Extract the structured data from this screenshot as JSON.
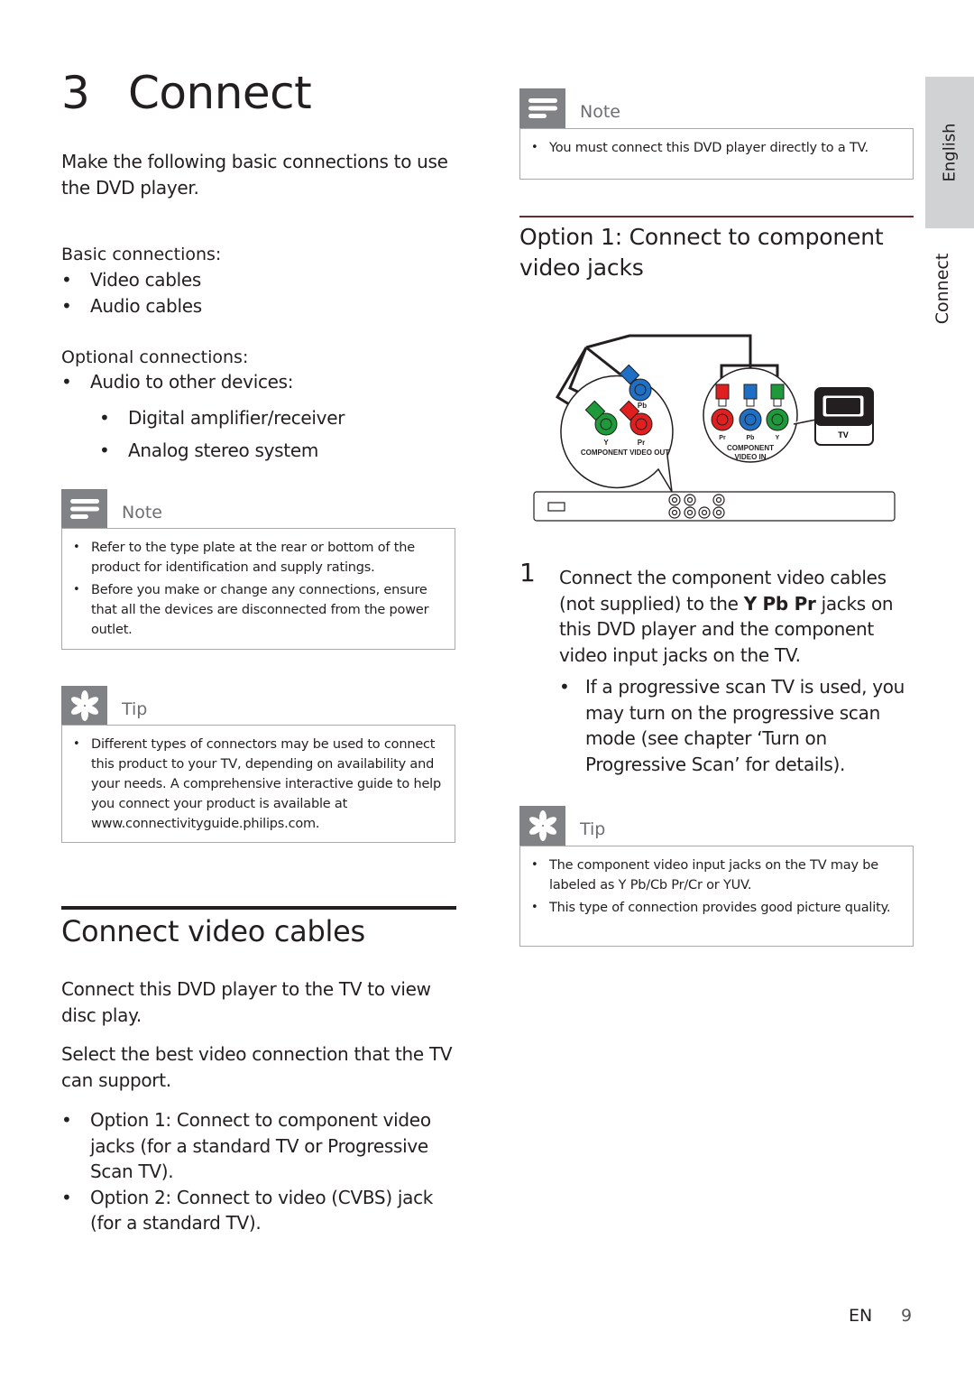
{
  "chapter": {
    "number": "3",
    "title": "Connect"
  },
  "intro": "Make the following basic connections to use the DVD player.",
  "basic": {
    "heading": "Basic connections:",
    "items": [
      "Video cables",
      "Audio cables"
    ]
  },
  "optional": {
    "heading": "Optional connections:",
    "item": "Audio to other devices:",
    "subitems": [
      "Digital amplifier/receiver",
      "Analog stereo system"
    ]
  },
  "note_left": {
    "title": "Note",
    "items": [
      "Refer to the type plate at the rear or bottom of the product for identification and supply ratings.",
      "Before you make or change any connections, ensure that all the devices are disconnected from the power outlet."
    ]
  },
  "tip_left": {
    "title": "Tip",
    "items": [
      "Different types of connectors may be used to connect this product to your TV, depending on availability and your needs. A comprehensive interactive guide to help you connect your product is available at www.connectivityguide.philips.com."
    ]
  },
  "video_section": {
    "heading": "Connect video cables",
    "para1": "Connect this DVD player to the TV to view disc play.",
    "para2": "Select the best video connection that the TV can support.",
    "options": [
      {
        "label": "Option 1:",
        "text": " Connect to component video jacks (for a standard TV or Progressive Scan TV)."
      },
      {
        "label": "Option 2:",
        "text": " Connect to video (CVBS) jack (for a standard TV)."
      }
    ]
  },
  "note_right": {
    "title": "Note",
    "items": [
      "You must connect this DVD player directly to a TV."
    ]
  },
  "option1": {
    "heading": "Option 1: Connect to component video jacks",
    "diagram": {
      "out_label": "COMPONENT VIDEO OUT",
      "in_label_1": "COMPONENT",
      "in_label_2": "VIDEO IN",
      "y": "Y",
      "pb": "Pb",
      "pr": "Pr",
      "tv": "TV",
      "colors": {
        "y": "#1e9a3a",
        "pb": "#1f6fc4",
        "pr": "#e02020"
      }
    },
    "step": {
      "number": "1",
      "pre": "Connect the component video cables (not supplied) to the ",
      "bold": "Y Pb Pr",
      "post": " jacks on this DVD player and the component video input jacks on the TV.",
      "sub": "If a progressive scan TV is used, you may turn on the progressive scan mode (see chapter ‘Turn on Progressive Scan’ for details)."
    }
  },
  "tip_right": {
    "title": "Tip",
    "items": [
      "The component video input jacks on the TV may be labeled as Y Pb/Cb Pr/Cr or YUV.",
      "This type of connection provides good picture quality."
    ]
  },
  "side_tabs": {
    "language": "English",
    "section": "Connect"
  },
  "footer": {
    "lang": "EN",
    "page": "9"
  }
}
